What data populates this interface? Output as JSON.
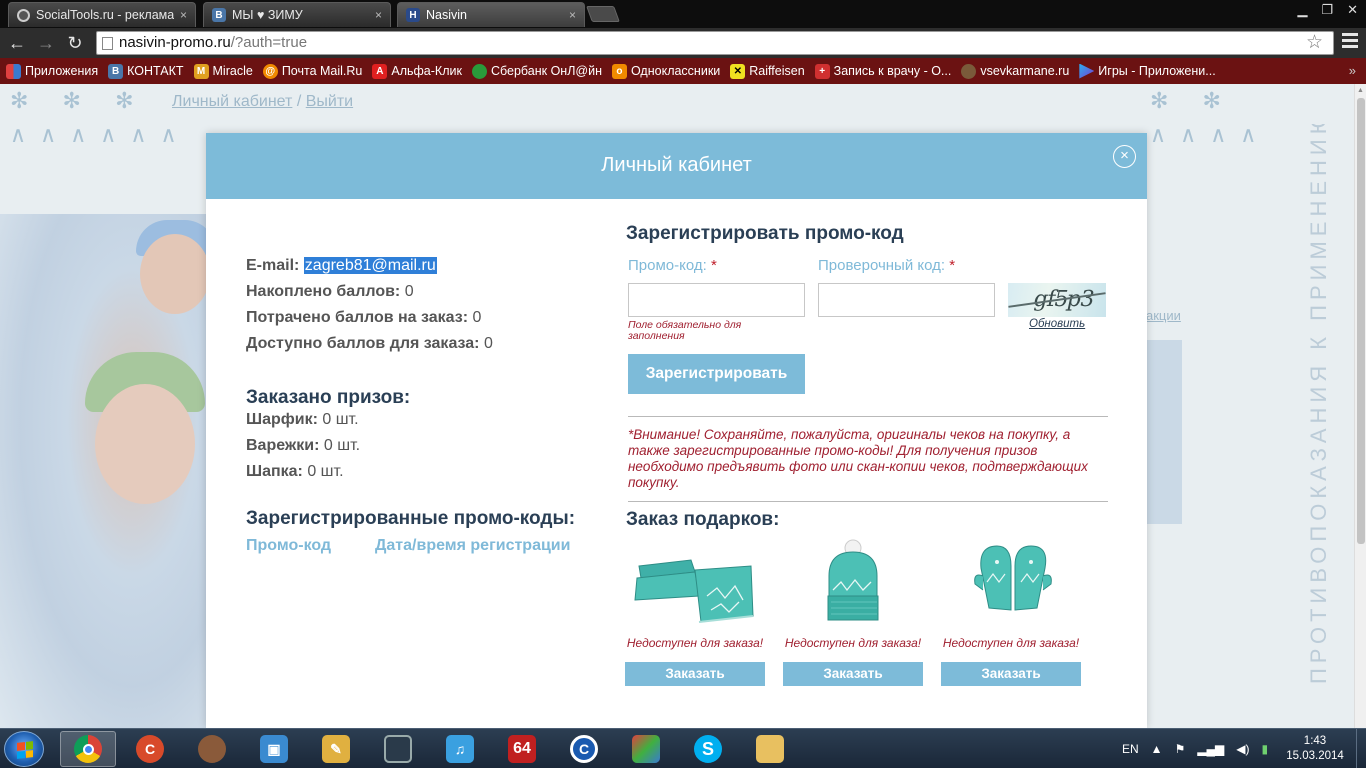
{
  "browser": {
    "tabs": [
      {
        "label": "SocialTools.ru - реклама",
        "icon": "socialtools-icon",
        "active": false
      },
      {
        "label": "МЫ ♥ ЗИМУ",
        "icon": "vk-icon",
        "active": false
      },
      {
        "label": "Nasivin",
        "icon": "nasivin-icon",
        "active": true
      }
    ],
    "address": {
      "host": "nasivin-promo.ru",
      "path": "/?auth=true"
    },
    "bookmarks": [
      {
        "label": "Приложения",
        "icon": "apps-icon",
        "color": "#e04040"
      },
      {
        "label": "КОНТАКТ",
        "icon": "vk-icon",
        "color": "#4a76a8"
      },
      {
        "label": "Miracle",
        "icon": "miracle-icon",
        "color": "#e0a020"
      },
      {
        "label": "Почта Mail.Ru",
        "icon": "mail-icon",
        "color": "#f08a00"
      },
      {
        "label": "Альфа-Клик",
        "icon": "alfa-icon",
        "color": "#e02020"
      },
      {
        "label": "Сбербанк ОнЛ@йн",
        "icon": "sberbank-icon",
        "color": "#2a9a3a"
      },
      {
        "label": "Одноклассники",
        "icon": "ok-icon",
        "color": "#f08a00"
      },
      {
        "label": "Raiffeisen",
        "icon": "raiffeisen-icon",
        "color": "#f0e020"
      },
      {
        "label": "Запись к врачу - О...",
        "icon": "doctor-icon",
        "color": "#d03030"
      },
      {
        "label": "vsevkarmane.ru",
        "icon": "vsevkarmane-icon",
        "color": "#7a5a3a"
      },
      {
        "label": "Игры - Приложени...",
        "icon": "games-icon",
        "color": "#7a3ad0"
      }
    ]
  },
  "background": {
    "nav": {
      "cabinet": "Личный кабинет",
      "sep": "/",
      "logout": "Выйти"
    },
    "vertical_text": "ПРОТИВОПОКАЗАНИЯ К ПРИМЕНЕНИЮ ОЗНАКОМЬТЕСЬ С ИНСТРУКЦИЕЙ ПО ПРИМЕНЕНИЮ",
    "right_link": "акции"
  },
  "modal": {
    "title": "Личный кабинет",
    "close": "×",
    "account": {
      "email_label": "E-mail:",
      "email": "zagreb81@mail.ru",
      "earned_label": "Накоплено баллов:",
      "earned": "0",
      "spent_label": "Потрачено баллов на заказ:",
      "spent": "0",
      "available_label": "Доступно баллов для заказа:",
      "available": "0"
    },
    "prizes_ordered": {
      "heading": "Заказано призов:",
      "items": [
        {
          "label": "Шарфик:",
          "value": "0 шт."
        },
        {
          "label": "Варежки:",
          "value": "0 шт."
        },
        {
          "label": "Шапка:",
          "value": "0 шт."
        }
      ]
    },
    "codes": {
      "heading": "Зарегистрированные промо-коды:",
      "col_code": "Промо-код",
      "col_date": "Дата/время регистрации"
    },
    "register": {
      "heading": "Зарегистрировать промо-код",
      "promo_label": "Промо-код:",
      "promo_value": "",
      "check_label": "Проверочный код:",
      "check_value": "",
      "required": "*",
      "error": "Поле обязательно для заполнения",
      "captcha_text": "gf5p3",
      "refresh": "Обновить",
      "submit": "Зарегистрировать"
    },
    "notice": "*Внимание! Сохраняйте, пожалуйста, оригиналы чеков на покупку, а также зарегистрированные промо-коды! Для получения призов необходимо предъявить фото или скан-копии чеков, подтверждающих покупку.",
    "gifts": {
      "heading": "Заказ подарков:",
      "items": [
        {
          "name": "scarf",
          "status": "Недоступен для заказа!",
          "button": "Заказать"
        },
        {
          "name": "hat",
          "status": "Недоступен для заказа!",
          "button": "Заказать"
        },
        {
          "name": "mittens",
          "status": "Недоступен для заказа!",
          "button": "Заказать"
        }
      ]
    }
  },
  "taskbar": {
    "lang": "EN",
    "time": "1:43",
    "date": "15.03.2014",
    "apps": [
      "chrome",
      "ccleaner",
      "file-manager",
      "archiver",
      "text-editor",
      "monitor",
      "music",
      "aida64",
      "browser-c",
      "cube",
      "skype",
      "explorer"
    ]
  },
  "colors": {
    "modal_header": "#7dbbd9",
    "accent_blue": "#7fb9d8",
    "error_red": "#a02030",
    "heading": "#2a3f55"
  }
}
